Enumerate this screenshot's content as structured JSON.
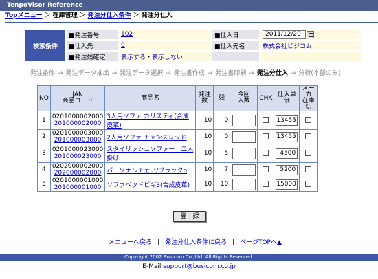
{
  "window": {
    "title": "TenpoVisor Reference"
  },
  "breadcrumb": {
    "top_link": "Topメニュー",
    "sep": "＞",
    "level1": "在庫管理",
    "level2_link": "発注分仕入条件",
    "current": "発注分仕入"
  },
  "search": {
    "header": "検索条件",
    "order_no_label": "■発注番号",
    "order_no_value": "102",
    "supplier_label": "■仕入先",
    "supplier_value": "0",
    "display_label": "■発注残確定",
    "show_link": "表示する",
    "dot": "・",
    "hide_link": "表示しない",
    "date_label": "■仕入日",
    "date_value": "2011/12/20",
    "supplier_name_label": "■仕入先名",
    "supplier_name_value": "株式会社ビジコム"
  },
  "steps": {
    "arrow": "→",
    "items": [
      "発注条件",
      "発注データ抽出",
      "発注データ選択",
      "発注書作成",
      "発注書印刷",
      "発注分仕入",
      "分荷(本部のみ)"
    ],
    "current_index": 5
  },
  "table": {
    "headers": {
      "no": "NO",
      "jan_1": "JAN",
      "jan_2": "商品コード",
      "name": "商品名",
      "qty": "発注数",
      "remain": "残",
      "today_1": "今回",
      "today_2": "入数",
      "chk": "CHK",
      "price": "仕入単価",
      "maker_1": "メーカ",
      "maker_2": "在庫切"
    },
    "rows": [
      {
        "no": "1",
        "jan": "0201000002000",
        "code": "201000002000",
        "name": "3人用ソファ カリスティ(合成皮革)",
        "qty": "10",
        "remain": "0",
        "price": "13455"
      },
      {
        "no": "2",
        "jan": "0201000003000",
        "code": "201000003000",
        "name": "2人用ソファ チャンスレッド",
        "qty": "10",
        "remain": "0",
        "price": "13455"
      },
      {
        "no": "3",
        "jan": "0201000023000",
        "code": "201000023000",
        "name": "スタイリッシュソファー　二人掛け",
        "qty": "10",
        "remain": "5",
        "price": "4500"
      },
      {
        "no": "4",
        "jan": "0202000002000",
        "code": "202000002000",
        "name": "パーソナルチェア/ブラックb",
        "qty": "10",
        "remain": "7",
        "price": "5200"
      },
      {
        "no": "5",
        "jan": "0201000001000",
        "code": "201000001000",
        "name": "ソファベッドビギ3(合成皮革)",
        "qty": "10",
        "remain": "10",
        "price": "15000"
      }
    ]
  },
  "register_button": "登　録",
  "footer": {
    "menu_link": "メニューへ戻る",
    "cond_link": "発注分仕入条件に戻る",
    "top_link": "ページTOPへ▲",
    "sep": "|",
    "copyright": "Copyright 2002 Busicom Co.,Ltd. All Rights Reserved.",
    "mail_label": "E-Mail",
    "mail_link": "support@busicom.co.jp"
  }
}
